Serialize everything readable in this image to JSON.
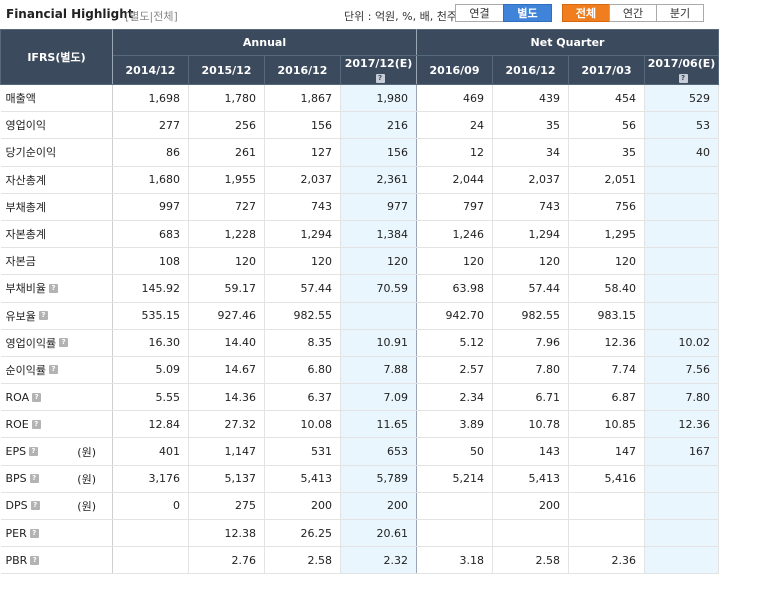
{
  "header": {
    "title": "Financial Highlight",
    "subtitle": "[별도|전체]",
    "unit": "단위 : 억원, %, 배, 천주",
    "basis_buttons": [
      {
        "label": "연결",
        "active": false
      },
      {
        "label": "별도",
        "active": true
      }
    ],
    "period_buttons": [
      {
        "label": "전체",
        "active": true
      },
      {
        "label": "연간",
        "active": false
      },
      {
        "label": "분기",
        "active": false
      }
    ]
  },
  "table": {
    "corner": "IFRS(별도)",
    "group_annual": "Annual",
    "group_quarter": "Net Quarter",
    "help_glyph": "?",
    "columns": [
      {
        "label": "2014/12",
        "help": false
      },
      {
        "label": "2015/12",
        "help": false
      },
      {
        "label": "2016/12",
        "help": false
      },
      {
        "label": "2017/12(E)",
        "help": true
      },
      {
        "label": "2016/09",
        "help": false
      },
      {
        "label": "2016/12",
        "help": false
      },
      {
        "label": "2017/03",
        "help": false
      },
      {
        "label": "2017/06(E)",
        "help": true
      }
    ],
    "rows": [
      {
        "label": "매출액",
        "help": false,
        "unit": "",
        "values": [
          "1,698",
          "1,780",
          "1,867",
          "1,980",
          "469",
          "439",
          "454",
          "529"
        ]
      },
      {
        "label": "영업이익",
        "help": false,
        "unit": "",
        "values": [
          "277",
          "256",
          "156",
          "216",
          "24",
          "35",
          "56",
          "53"
        ]
      },
      {
        "label": "당기순이익",
        "help": false,
        "unit": "",
        "values": [
          "86",
          "261",
          "127",
          "156",
          "12",
          "34",
          "35",
          "40"
        ]
      },
      {
        "label": "자산총계",
        "help": false,
        "unit": "",
        "values": [
          "1,680",
          "1,955",
          "2,037",
          "2,361",
          "2,044",
          "2,037",
          "2,051",
          ""
        ]
      },
      {
        "label": "부채총계",
        "help": false,
        "unit": "",
        "values": [
          "997",
          "727",
          "743",
          "977",
          "797",
          "743",
          "756",
          ""
        ]
      },
      {
        "label": "자본총계",
        "help": false,
        "unit": "",
        "values": [
          "683",
          "1,228",
          "1,294",
          "1,384",
          "1,246",
          "1,294",
          "1,295",
          ""
        ]
      },
      {
        "label": "자본금",
        "help": false,
        "unit": "",
        "values": [
          "108",
          "120",
          "120",
          "120",
          "120",
          "120",
          "120",
          ""
        ]
      },
      {
        "label": "부채비율",
        "help": true,
        "unit": "",
        "values": [
          "145.92",
          "59.17",
          "57.44",
          "70.59",
          "63.98",
          "57.44",
          "58.40",
          ""
        ]
      },
      {
        "label": "유보율",
        "help": true,
        "unit": "",
        "values": [
          "535.15",
          "927.46",
          "982.55",
          "",
          "942.70",
          "982.55",
          "983.15",
          ""
        ]
      },
      {
        "label": "영업이익률",
        "help": true,
        "unit": "",
        "values": [
          "16.30",
          "14.40",
          "8.35",
          "10.91",
          "5.12",
          "7.96",
          "12.36",
          "10.02"
        ]
      },
      {
        "label": "순이익률",
        "help": true,
        "unit": "",
        "values": [
          "5.09",
          "14.67",
          "6.80",
          "7.88",
          "2.57",
          "7.80",
          "7.74",
          "7.56"
        ]
      },
      {
        "label": "ROA",
        "help": true,
        "unit": "",
        "values": [
          "5.55",
          "14.36",
          "6.37",
          "7.09",
          "2.34",
          "6.71",
          "6.87",
          "7.80"
        ]
      },
      {
        "label": "ROE",
        "help": true,
        "unit": "",
        "values": [
          "12.84",
          "27.32",
          "10.08",
          "11.65",
          "3.89",
          "10.78",
          "10.85",
          "12.36"
        ]
      },
      {
        "label": "EPS",
        "help": true,
        "unit": "(원)",
        "values": [
          "401",
          "1,147",
          "531",
          "653",
          "50",
          "143",
          "147",
          "167"
        ]
      },
      {
        "label": "BPS",
        "help": true,
        "unit": "(원)",
        "values": [
          "3,176",
          "5,137",
          "5,413",
          "5,789",
          "5,214",
          "5,413",
          "5,416",
          ""
        ]
      },
      {
        "label": "DPS",
        "help": true,
        "unit": "(원)",
        "values": [
          "0",
          "275",
          "200",
          "200",
          "",
          "200",
          "",
          ""
        ]
      },
      {
        "label": "PER",
        "help": true,
        "unit": "",
        "values": [
          "",
          "12.38",
          "26.25",
          "20.61",
          "",
          "",
          "",
          ""
        ]
      },
      {
        "label": "PBR",
        "help": true,
        "unit": "",
        "values": [
          "",
          "2.76",
          "2.58",
          "2.32",
          "3.18",
          "2.58",
          "2.36",
          ""
        ]
      }
    ]
  }
}
